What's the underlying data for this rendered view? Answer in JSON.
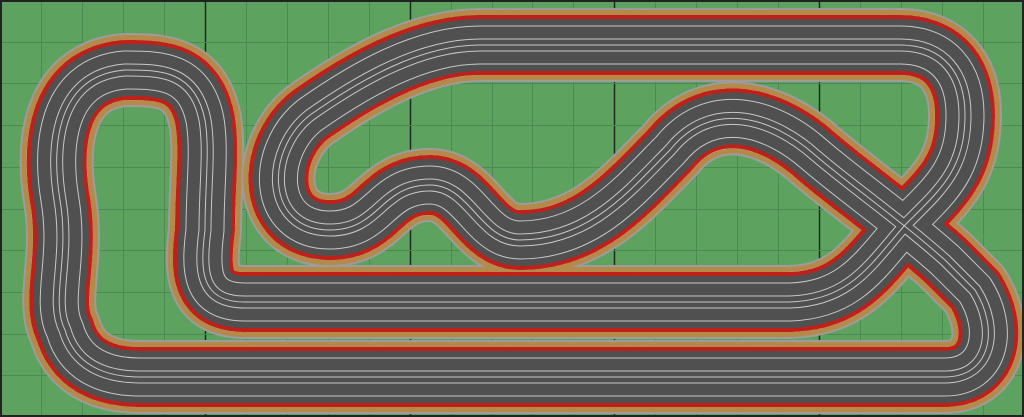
{
  "board": {
    "grid_columns": 25,
    "grid_rows": 10,
    "major_grid_every": 5,
    "lanes": 4
  },
  "colors": {
    "grass": "#5ea260",
    "grid_minor": "#4d8a51",
    "grid_major": "#1d2a1e",
    "frame": "#222222",
    "asphalt": "#505050",
    "lane_line": "#c8c8c8",
    "shoulder": "#b5894a",
    "curb_white": "#f2f2f2",
    "curb_red": "#c0201a",
    "edge": "#9c9c9c"
  }
}
